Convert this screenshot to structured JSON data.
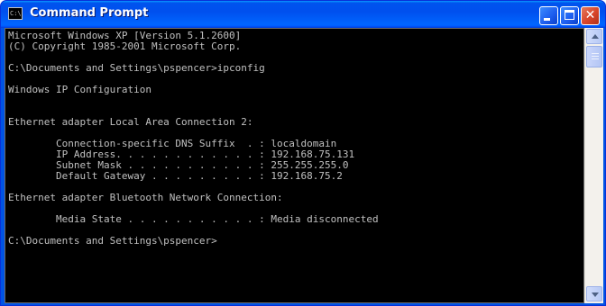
{
  "window": {
    "title": "Command Prompt",
    "icon": "console-app-icon",
    "icon_glyph": "C:\\",
    "caption_buttons": {
      "minimize": "minimize-icon",
      "maximize": "maximize-icon",
      "close_glyph": "✕"
    }
  },
  "console": {
    "lines": [
      "Microsoft Windows XP [Version 5.1.2600]",
      "(C) Copyright 1985-2001 Microsoft Corp.",
      "",
      "C:\\Documents and Settings\\pspencer>ipconfig",
      "",
      "Windows IP Configuration",
      "",
      "",
      "Ethernet adapter Local Area Connection 2:",
      "",
      "        Connection-specific DNS Suffix  . : localdomain",
      "        IP Address. . . . . . . . . . . . : 192.168.75.131",
      "        Subnet Mask . . . . . . . . . . . : 255.255.255.0",
      "        Default Gateway . . . . . . . . . : 192.168.75.2",
      "",
      "Ethernet adapter Bluetooth Network Connection:",
      "",
      "        Media State . . . . . . . . . . . : Media disconnected",
      "",
      "C:\\Documents and Settings\\pspencer>"
    ]
  },
  "colors": {
    "titlebar": "#0054e3",
    "console_background": "#000000",
    "console_text": "#c0c0c0"
  }
}
